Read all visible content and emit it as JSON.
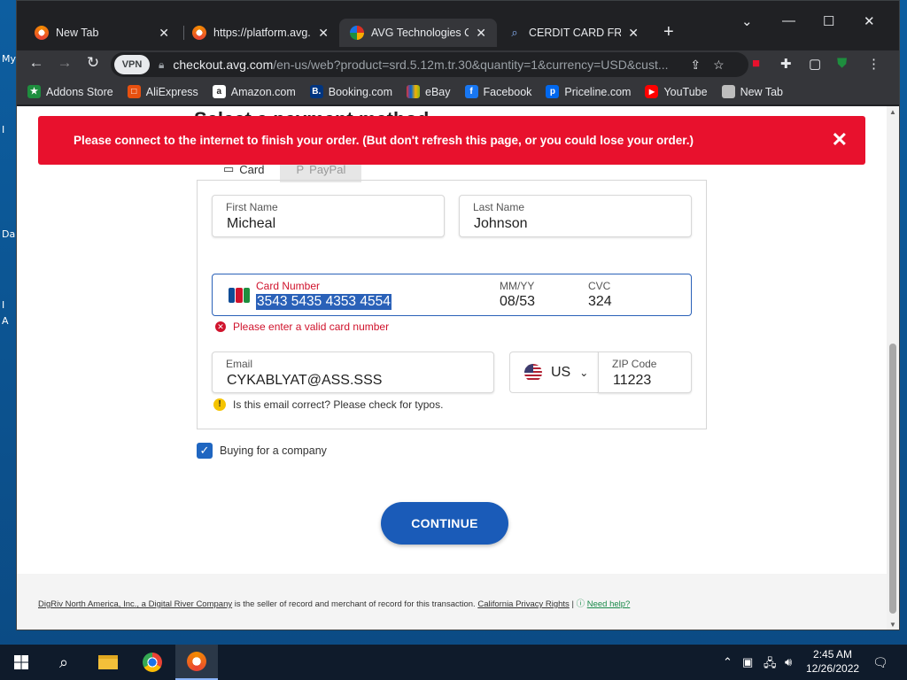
{
  "desktop": {
    "fragments": [
      "My",
      "I",
      "Da",
      "I",
      "A"
    ]
  },
  "tabs": [
    {
      "title": "New Tab",
      "icon": "avg-browser-icon"
    },
    {
      "title": "https://platform.avg.c",
      "icon": "avg-browser-icon"
    },
    {
      "title": "AVG Technologies On",
      "icon": "avg-icon"
    },
    {
      "title": "CERDIT CARD FREE -",
      "icon": "search-icon"
    }
  ],
  "toolbar": {
    "vpn_label": "VPN",
    "url_host": "checkout.avg.com",
    "url_path": "/en-us/web?product=srd.5.12m.tr.30&quantity=1&currency=USD&cust..."
  },
  "bookmarks": [
    {
      "label": "Addons Store",
      "color": "#1e8e3e",
      "glyph": "★"
    },
    {
      "label": "AliExpress",
      "color": "#e8500f",
      "glyph": "□"
    },
    {
      "label": "Amazon.com",
      "color": "#222222",
      "glyph": "a"
    },
    {
      "label": "Booking.com",
      "color": "#003580",
      "glyph": "B."
    },
    {
      "label": "eBay",
      "color": "#444444",
      "glyph": "e"
    },
    {
      "label": "Facebook",
      "color": "#1877f2",
      "glyph": "f"
    },
    {
      "label": "Priceline.com",
      "color": "#0068ef",
      "glyph": "p"
    },
    {
      "label": "YouTube",
      "color": "#ff0000",
      "glyph": "▶"
    },
    {
      "label": "New Tab",
      "color": "#bdbdbd",
      "glyph": ""
    }
  ],
  "page": {
    "alert_text": "Please connect to the internet to finish your order. (But don't refresh this page, or you could lose your order.)",
    "heading_peek": "Select a payment method",
    "payment_tabs": [
      "Card",
      "PayPal"
    ],
    "first_name_label": "First Name",
    "first_name_value": "Micheal",
    "last_name_label": "Last Name",
    "last_name_value": "Johnson",
    "card_number_label": "Card Number",
    "card_number_value": "3543 5435 4353 4554",
    "expiry_label": "MM/YY",
    "expiry_value": "08/53",
    "cvc_label": "CVC",
    "cvc_value": "324",
    "card_error": "Please enter a valid card number",
    "email_label": "Email",
    "email_value": "CYKABLYAT@ASS.SSS",
    "email_warning": "Is this email correct? Please check for typos.",
    "country_value": "US",
    "zip_label": "ZIP Code",
    "zip_value": "11223",
    "company_checkbox_label": "Buying for a company",
    "company_checked": true,
    "continue_label": "CONTINUE",
    "footer_company_link": "DigRiv North America, Inc., a Digital River Company",
    "footer_text": " is the seller of record and merchant of record for this transaction. ",
    "footer_privacy_link": "California Privacy Rights",
    "footer_help": "Need help?"
  },
  "taskbar": {
    "time": "2:45 AM",
    "date": "12/26/2022"
  },
  "colors": {
    "alert_red": "#e8112d",
    "primary_blue": "#1a5bb8",
    "error_red": "#d0132c"
  }
}
